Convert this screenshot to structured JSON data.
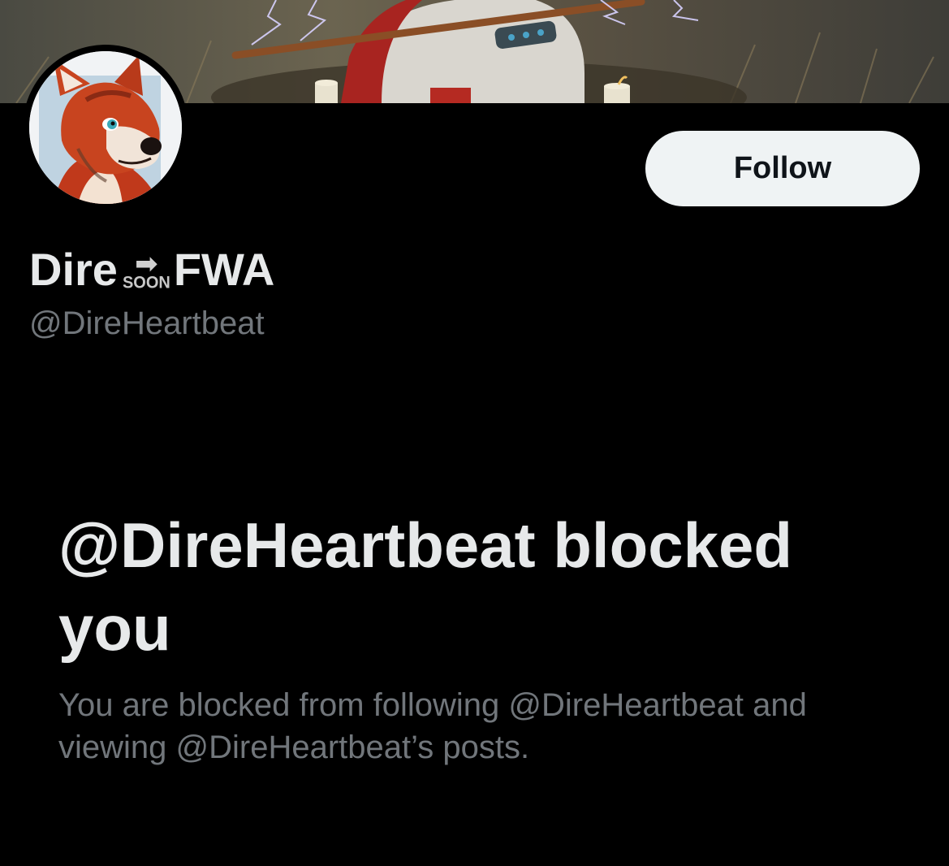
{
  "profile": {
    "display_name_before": "Dire",
    "display_name_emoji_label": "SOON",
    "display_name_emoji_icon": "soon-arrow-icon",
    "display_name_after": "FWA",
    "handle": "@DireHeartbeat",
    "follow_label": "Follow"
  },
  "blocked": {
    "title": "@DireHeartbeat blocked you",
    "description": "You are blocked from following @DireHeartbeat and viewing @DireHeartbeat’s posts."
  },
  "colors": {
    "background": "#000000",
    "primary_text": "#e7e9ea",
    "secondary_text": "#71767b",
    "follow_button_bg": "#eff3f4",
    "follow_button_text": "#0f1419"
  }
}
